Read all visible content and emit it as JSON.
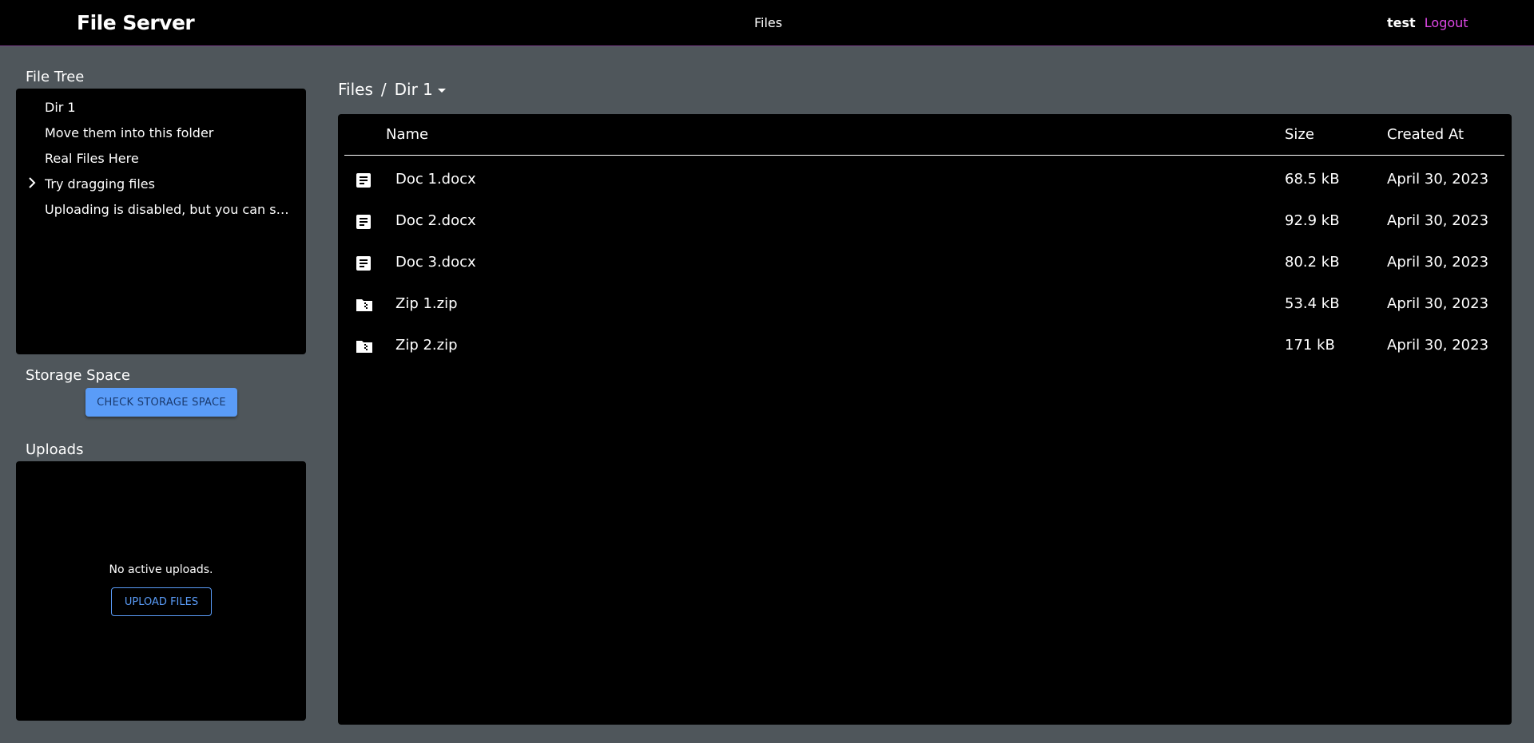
{
  "header": {
    "brand": "File Server",
    "nav_files": "Files",
    "username": "test",
    "logout": "Logout"
  },
  "sidebar": {
    "file_tree_title": "File Tree",
    "tree_items": [
      {
        "label": "Dir 1",
        "expandable": false
      },
      {
        "label": "Move them into this folder",
        "expandable": false
      },
      {
        "label": "Real Files Here",
        "expandable": false
      },
      {
        "label": "Try dragging files",
        "expandable": true
      },
      {
        "label": "Uploading is disabled, but you can still try it",
        "expandable": false
      }
    ],
    "storage_title": "Storage Space",
    "check_storage_label": "CHECK STORAGE SPACE",
    "uploads_title": "Uploads",
    "no_uploads_text": "No active uploads.",
    "upload_files_label": "UPLOAD FILES"
  },
  "main": {
    "breadcrumb": [
      "Files",
      "/",
      "Dir 1"
    ],
    "columns": {
      "name": "Name",
      "size": "Size",
      "created": "Created At"
    },
    "files": [
      {
        "name": "Doc 1.docx",
        "size": "68.5 kB",
        "created": "April 30, 2023",
        "icon": "document-icon"
      },
      {
        "name": "Doc 2.docx",
        "size": "92.9 kB",
        "created": "April 30, 2023",
        "icon": "document-icon"
      },
      {
        "name": "Doc 3.docx",
        "size": "80.2 kB",
        "created": "April 30, 2023",
        "icon": "document-icon"
      },
      {
        "name": "Zip 1.zip",
        "size": "53.4 kB",
        "created": "April 30, 2023",
        "icon": "zip-folder-icon"
      },
      {
        "name": "Zip 2.zip",
        "size": "171 kB",
        "created": "April 30, 2023",
        "icon": "zip-folder-icon"
      }
    ]
  },
  "colors": {
    "accent": "#5a9cf8",
    "logout": "#e048e8",
    "background": "#4f565b",
    "panel": "#000000"
  }
}
